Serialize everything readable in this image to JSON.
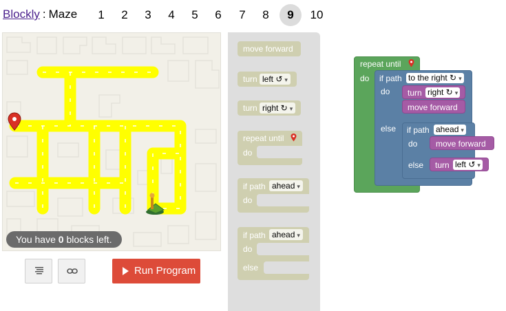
{
  "header": {
    "brand_link": "Blockly",
    "separator": ":",
    "app_name": "Maze",
    "levels": [
      "1",
      "2",
      "3",
      "4",
      "5",
      "6",
      "7",
      "8",
      "9",
      "10"
    ],
    "active_level": "9"
  },
  "maze": {
    "blocks_left_prefix": "You have ",
    "blocks_left_count": "0",
    "blocks_left_suffix": " blocks left."
  },
  "controls": {
    "run_label": "Run Program"
  },
  "toolbox": {
    "move_forward": "move forward",
    "turn1": "turn",
    "turn1_dd": "left ↺",
    "turn2": "turn",
    "turn2_dd": "right ↻",
    "repeat_until": "repeat until",
    "repeat_do": "do",
    "ifpath": "if path",
    "ifpath_dd": "ahead",
    "ifpath_do": "do",
    "ifelse": "if path",
    "ifelse_dd": "ahead",
    "ifelse_do": "do",
    "ifelse_else": "else"
  },
  "workspace": {
    "repeat_until": "repeat until",
    "repeat_do": "do",
    "if1": "if path",
    "if1_dd": "to the right ↻",
    "if1_do": "do",
    "turn_a": "turn",
    "turn_a_dd": "right ↻",
    "move1": "move forward",
    "if1_else": "else",
    "if2": "if path",
    "if2_dd": "ahead",
    "if2_do": "do",
    "move2": "move forward",
    "if2_else": "else",
    "turn_b": "turn",
    "turn_b_dd": "left ↺"
  },
  "colors": {
    "loop": "#5ba55b",
    "logic": "#5b80a5",
    "movement": "#a55ba5",
    "run": "#dd4b39",
    "path": "#ffff00"
  }
}
